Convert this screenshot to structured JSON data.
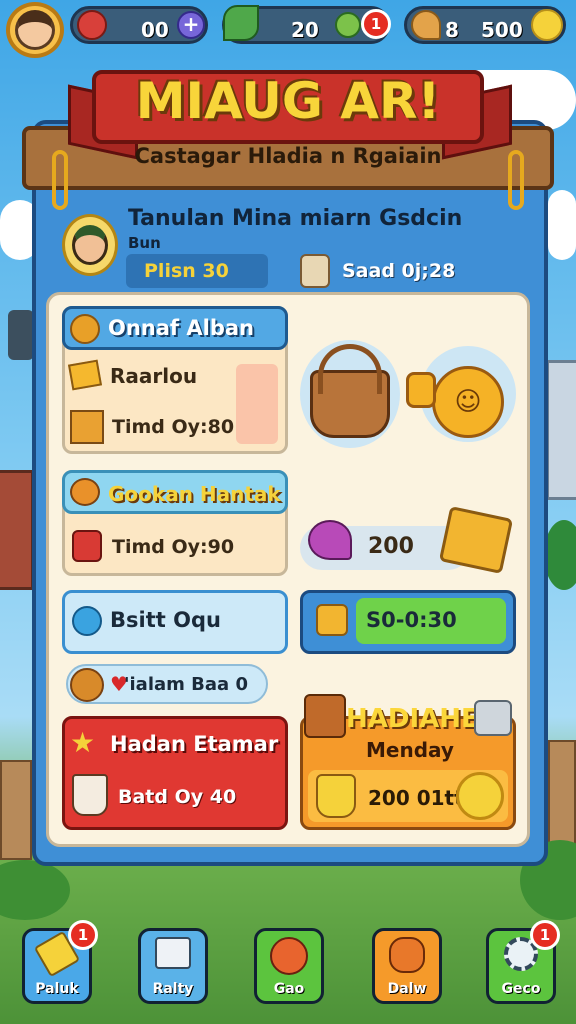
{
  "hud": {
    "resource1_value": "00",
    "resource2_value": "20",
    "resource2_badge": "1",
    "resource3_value": "500"
  },
  "banner": {
    "title": "MIAUG AR!",
    "subtitle": "Castagar Hladia n Rgaiain"
  },
  "player": {
    "headline": "Tanulan Mina miarn Gsdcin",
    "name": "Bun",
    "stat1": "Plisn 30",
    "stat2": "Saad 0j;28"
  },
  "cards": {
    "c1_title": "Onnaf Alban",
    "c1_line1": "Raarlou",
    "c1_line2": "Timd Oy:80",
    "c2_title": "Gookan Hantak",
    "c2_line1": "Timd Oy:90",
    "reward1": "200",
    "c3_label": "Bsitt Oqu",
    "timer": "S0-0:30",
    "tag": "'ialam Baa 0",
    "c4_title": "Hadan Etamar",
    "c4_line1": "Batd Oy 40",
    "shop_title": "HADIAHE",
    "shop_sub": "Menday",
    "shop_value": "200 01tt"
  },
  "nav": [
    {
      "label": "Paluk",
      "badge": "1"
    },
    {
      "label": "Ralty",
      "badge": ""
    },
    {
      "label": "Gao",
      "badge": ""
    },
    {
      "label": "Dalw",
      "badge": ""
    },
    {
      "label": "Geco",
      "badge": "1"
    }
  ],
  "colors": {
    "accent_blue": "#3f8fd6",
    "ribbon_red": "#c9322a",
    "gold": "#f5c518",
    "green": "#5fc43b"
  }
}
